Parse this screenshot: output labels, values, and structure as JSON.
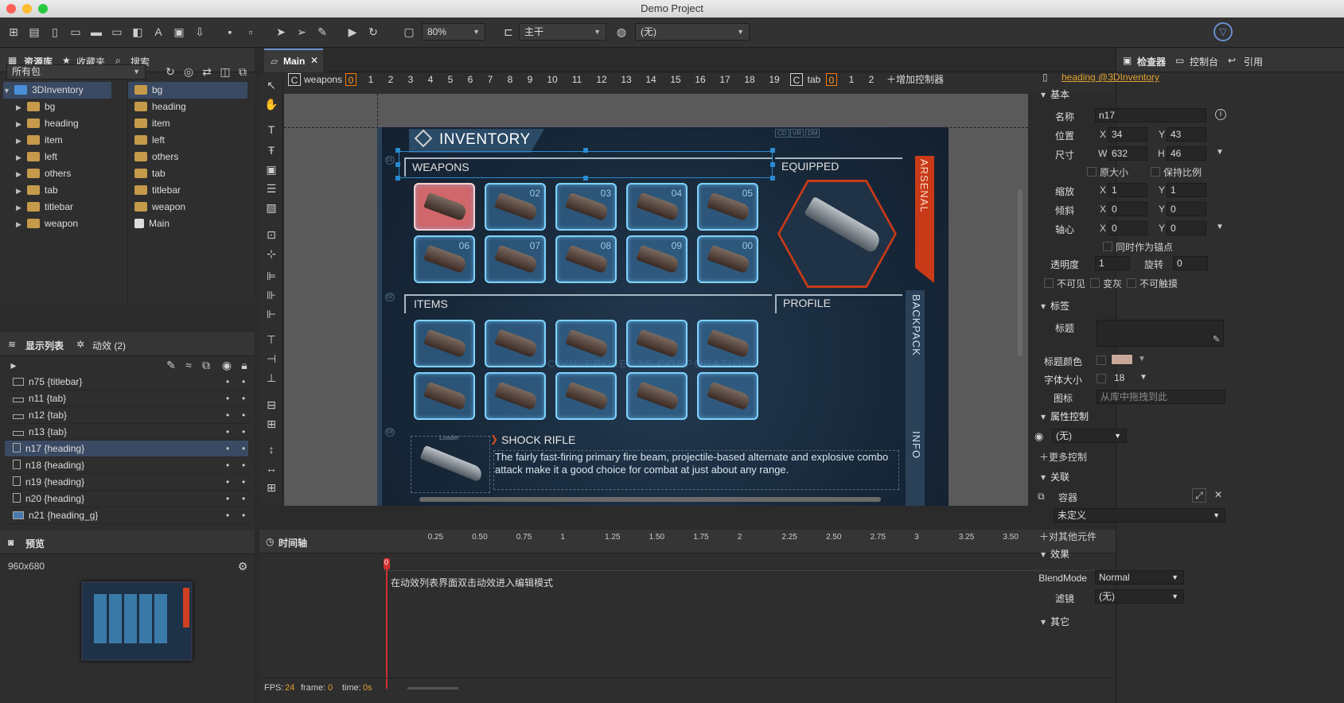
{
  "window": {
    "title": "Demo Project"
  },
  "toolbar": {
    "zoom": "80%",
    "main_select": "主干",
    "lang_select": "(无)"
  },
  "library": {
    "tabs": [
      "资源库",
      "收藏夹",
      "搜索"
    ],
    "package": "所有包",
    "tree": [
      "3DInventory",
      "bg",
      "heading",
      "item",
      "left",
      "others",
      "tab",
      "titlebar",
      "weapon"
    ],
    "files": [
      "bg",
      "heading",
      "item",
      "left",
      "others",
      "tab",
      "titlebar",
      "weapon",
      "Main"
    ]
  },
  "display_list": {
    "tabs": [
      "显示列表",
      "动效 (2)"
    ],
    "rows": [
      "n75 {titlebar}",
      "n11 {tab}",
      "n12 {tab}",
      "n13 {tab}",
      "n17 {heading}",
      "n18 {heading}",
      "n19 {heading}",
      "n20 {heading}",
      "n21 {heading_g}"
    ]
  },
  "preview": {
    "tab": "预览",
    "size": "960x680"
  },
  "doc_tab": {
    "label": "Main"
  },
  "gears": {
    "c1_name": "weapons",
    "c1_pages": [
      "0",
      "1",
      "2",
      "3",
      "4",
      "5",
      "6",
      "7",
      "8",
      "9",
      "10",
      "11",
      "12",
      "13",
      "14",
      "15",
      "16",
      "17",
      "18",
      "19"
    ],
    "c2_name": "tab",
    "c2_pages": [
      "0",
      "1",
      "2"
    ],
    "add_controller": "增加控制器",
    "c_label": "C"
  },
  "canvas": {
    "inventory": "INVENTORY",
    "weapons": "WEAPONS",
    "equipped": "EQUIPPED",
    "items": "ITEMS",
    "profile": "PROFILE",
    "arsenal": "ARSENAL",
    "backpack": "BACKPACK",
    "info": "INFO",
    "shock_title": "SHOCK RIFLE",
    "shock_desc": "The fairly fast-firing primary fire beam, projectile-based alternate and explosive combo attack make it a good choice for combat at just about any range.",
    "loader": "Loader",
    "bg_text": "CIVIL PROJECTS CORPORATION",
    "cd": "CD",
    "vr": "VR",
    "dm": "DM",
    "weapon_nums": [
      "",
      "02",
      "03",
      "04",
      "05",
      "06",
      "07",
      "08",
      "09",
      "00"
    ],
    "side_nums": [
      "01",
      "02",
      "03"
    ]
  },
  "timeline": {
    "tab": "时间轴",
    "ticks": [
      "0",
      "0.25",
      "0.50",
      "0.75",
      "1",
      "1.25",
      "1.50",
      "1.75",
      "2",
      "2.25",
      "2.50",
      "2.75",
      "3",
      "3.25",
      "3.50"
    ],
    "hint": "在动效列表界面双击动效进入编辑模式",
    "fps_label": "FPS:",
    "fps": "24",
    "frame_label": "frame:",
    "frame": "0",
    "time_label": "time:",
    "time": "0s"
  },
  "inspector": {
    "tabs": [
      "检查器",
      "控制台",
      "引用"
    ],
    "link": "heading @3DInventory",
    "basic": "基本",
    "name_label": "名称",
    "name": "n17",
    "pos_label": "位置",
    "x": "34",
    "y": "43",
    "size_label": "尺寸",
    "w": "632",
    "h": "46",
    "original_size": "原大小",
    "keep_ratio": "保持比例",
    "scale_label": "缩放",
    "sx": "1",
    "sy": "1",
    "skew_label": "倾斜",
    "kx": "0",
    "ky": "0",
    "pivot_label": "轴心",
    "px": "0",
    "py": "0",
    "as_anchor": "同时作为锚点",
    "alpha_label": "透明度",
    "alpha": "1",
    "rotate_label": "旋转",
    "rotation": "0",
    "invisible": "不可见",
    "gray": "变灰",
    "untouchable": "不可触摸",
    "label_sec": "标签",
    "title_label": "标题",
    "title_color": "标题颜色",
    "font_size_label": "字体大小",
    "font_size": "18",
    "icon_label": "图标",
    "icon_placeholder": "从库中拖拽到此",
    "prop_ctrl": "属性控制",
    "prop_ctrl_val": "(无)",
    "more_ctrl": "更多控制",
    "relation": "关联",
    "container": "容器",
    "undefined_val": "未定义",
    "other_rel": "对其他元件",
    "effect": "效果",
    "blend_label": "BlendMode",
    "blend": "Normal",
    "filter_label": "滤镜",
    "filter": "(无)",
    "other": "其它",
    "X": "X",
    "Y": "Y",
    "W": "W",
    "H": "H",
    "swatch_color": "#c8a898"
  }
}
